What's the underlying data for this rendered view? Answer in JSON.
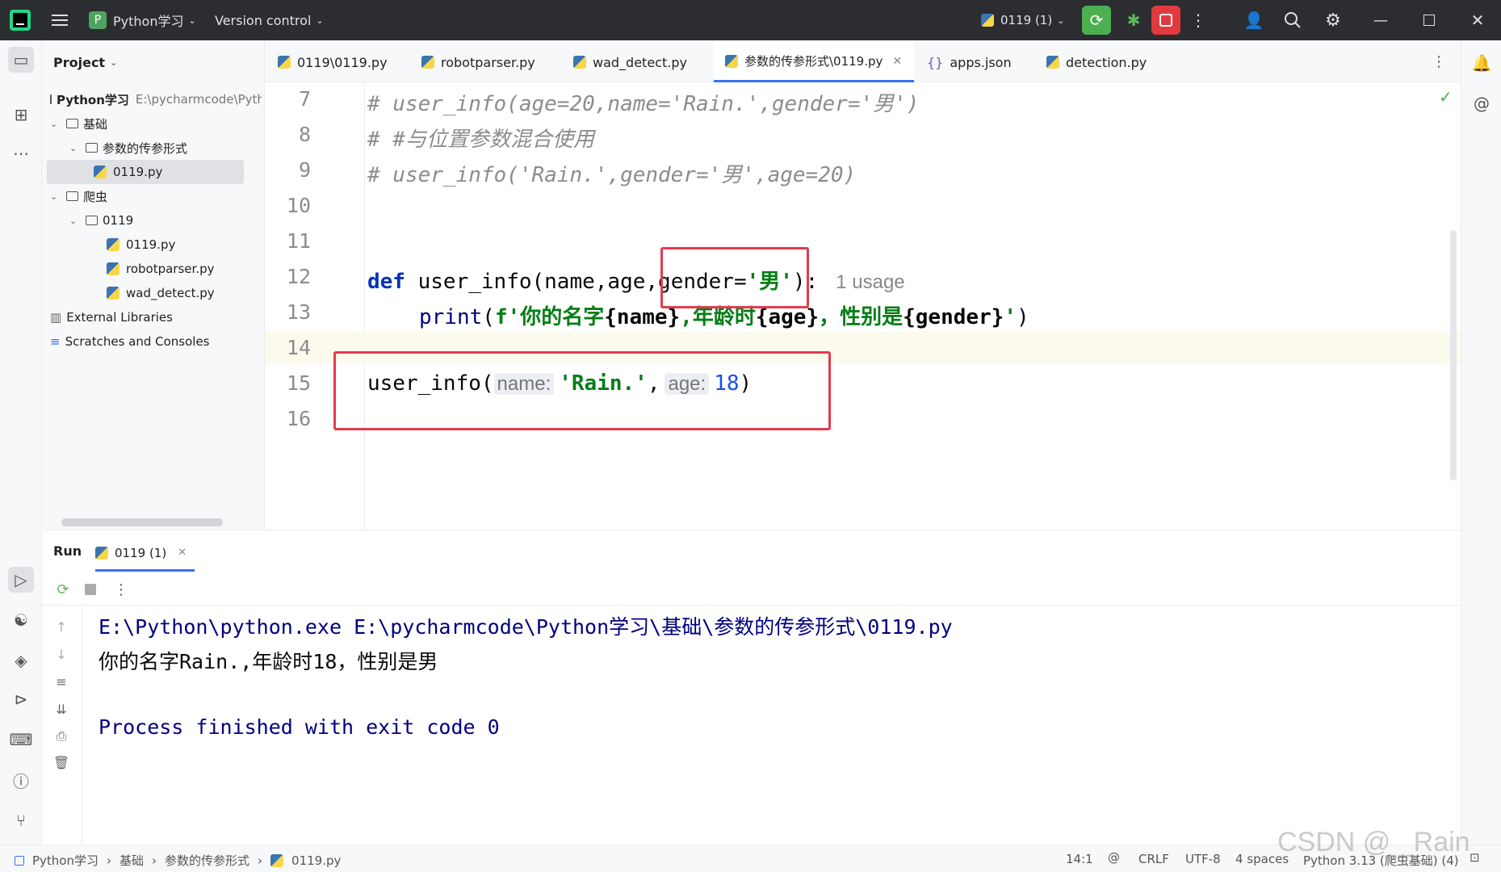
{
  "titlebar": {
    "project_badge": "P",
    "project_name": "Python学习",
    "vcs_label": "Version control",
    "run_config": "0119 (1)"
  },
  "tabs": [
    {
      "label": "0119\\0119.py",
      "active": false
    },
    {
      "label": "robotparser.py",
      "active": false
    },
    {
      "label": "wad_detect.py",
      "active": false
    },
    {
      "label": "参数的传参形式\\0119.py",
      "active": true
    },
    {
      "label": "apps.json",
      "active": false
    },
    {
      "label": "detection.py",
      "active": false
    }
  ],
  "project_panel": {
    "header": "Project",
    "root_name": "Python学习",
    "root_path": "E:\\pycharmcode\\Pyth",
    "items": [
      {
        "label": "基础"
      },
      {
        "label": "参数的传参形式"
      },
      {
        "label": "0119.py"
      },
      {
        "label": "爬虫"
      },
      {
        "label": "0119"
      },
      {
        "label": "0119.py"
      },
      {
        "label": "robotparser.py"
      },
      {
        "label": "wad_detect.py"
      },
      {
        "label": "External Libraries"
      },
      {
        "label": "Scratches and Consoles"
      }
    ]
  },
  "editor": {
    "line_numbers": [
      "7",
      "8",
      "9",
      "10",
      "11",
      "12",
      "13",
      "14",
      "15",
      "16"
    ],
    "lines": {
      "l7": "# user_info(age=20,name='Rain.',gender='男')",
      "l8": "# #与位置参数混合使用",
      "l9": "# user_info('Rain.',gender='男',age=20)",
      "l12_kw": "def",
      "l12_sig": " user_info(name,age,gender=",
      "l12_str": "'男'",
      "l12_end": "):",
      "l12_usage": "1 usage",
      "l13_builtin": "print",
      "l13_open": "(",
      "l13_f": "f'你的名字",
      "l13_b1": "{name}",
      "l13_mid1": ",年龄时",
      "l13_b2": "{age}",
      "l13_mid2": "，性别是",
      "l13_b3": "{gender}",
      "l13_q": "'",
      "l13_close": ")",
      "l15_call": "user_info(",
      "l15_hint1": "name:",
      "l15_arg1": "'Rain.'",
      "l15_comma": ",",
      "l15_hint2": "age:",
      "l15_arg2": "18",
      "l15_close": ")"
    }
  },
  "run_panel": {
    "title": "Run",
    "tab_label": "0119 (1)",
    "output": [
      "E:\\Python\\python.exe E:\\pycharmcode\\Python学习\\基础\\参数的传参形式\\0119.py",
      "你的名字Rain.,年龄时18，性别是男",
      "",
      "Process finished with exit code 0"
    ]
  },
  "statusbar": {
    "breadcrumb": [
      "Python学习",
      "基础",
      "参数的传参形式",
      "0119.py"
    ],
    "position": "14:1",
    "line_sep": "CRLF",
    "encoding": "UTF-8",
    "indent": "4 spaces",
    "interpreter": "Python 3.13 (爬虫基础) (4)",
    "watermark": "CSDN @ _Rain"
  },
  "colors": {
    "accent_red_box": "#e33b4f",
    "run_button": "#4caf50",
    "stop_button": "#e03a3e",
    "keyword": "#0033b3",
    "string": "#067d17",
    "comment": "#8c8c8c",
    "console_blue": "#000080"
  }
}
